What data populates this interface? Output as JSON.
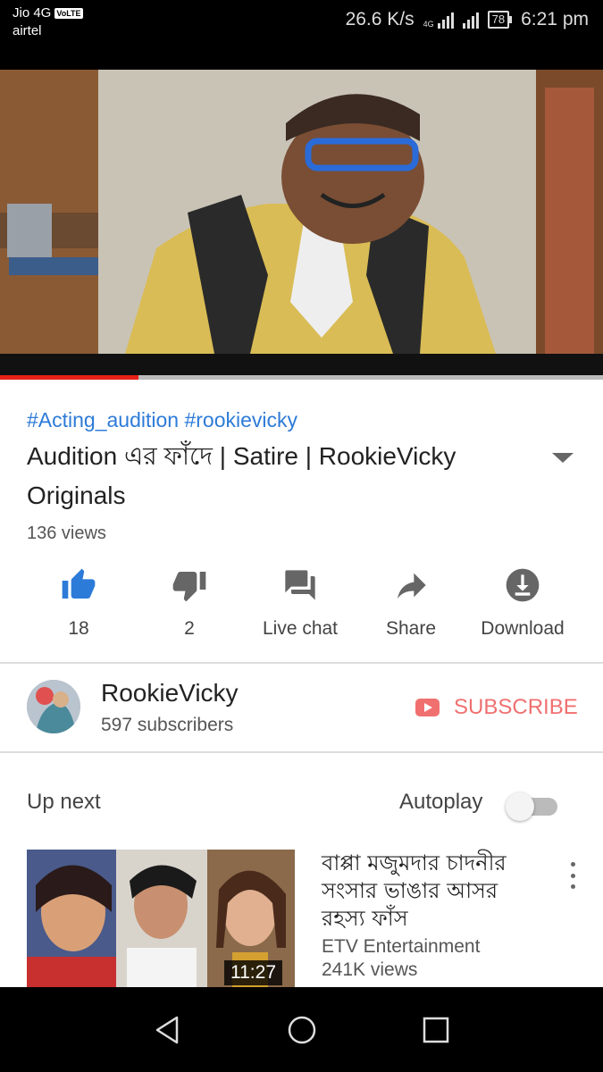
{
  "status_bar": {
    "carrier_primary": "Jio 4G",
    "volte_badge": "VoLTE",
    "carrier_secondary": "airtel",
    "speed": "26.6 K/s",
    "network_type": "4G",
    "battery": "78",
    "time": "6:21 pm"
  },
  "player": {
    "progress_fraction": 0.23,
    "progress_color": "#e62117"
  },
  "video": {
    "hashtags": "#Acting_audition #rookievicky",
    "title": "Audition এর  ফাঁদে | Satire | RookieVicky Originals",
    "views": "136 views"
  },
  "actions": {
    "like_count": "18",
    "dislike_count": "2",
    "live_chat_label": "Live chat",
    "share_label": "Share",
    "download_label": "Download"
  },
  "channel": {
    "name": "RookieVicky",
    "subscribers": "597 subscribers",
    "subscribe_label": "SUBSCRIBE"
  },
  "up_next": {
    "label": "Up next",
    "autoplay_label": "Autoplay",
    "autoplay_on": false
  },
  "suggestion": {
    "title": "বাপ্পা মজুমদার চাদনীর সংসার ভাঙার আসর রহস্য ফাঁস",
    "channel": "ETV Entertainment",
    "views": "241K views",
    "duration": "11:27"
  },
  "colors": {
    "accent_blue": "#2d7bd8",
    "subscribe_red": "#f07070",
    "icon_gray": "#666666"
  }
}
